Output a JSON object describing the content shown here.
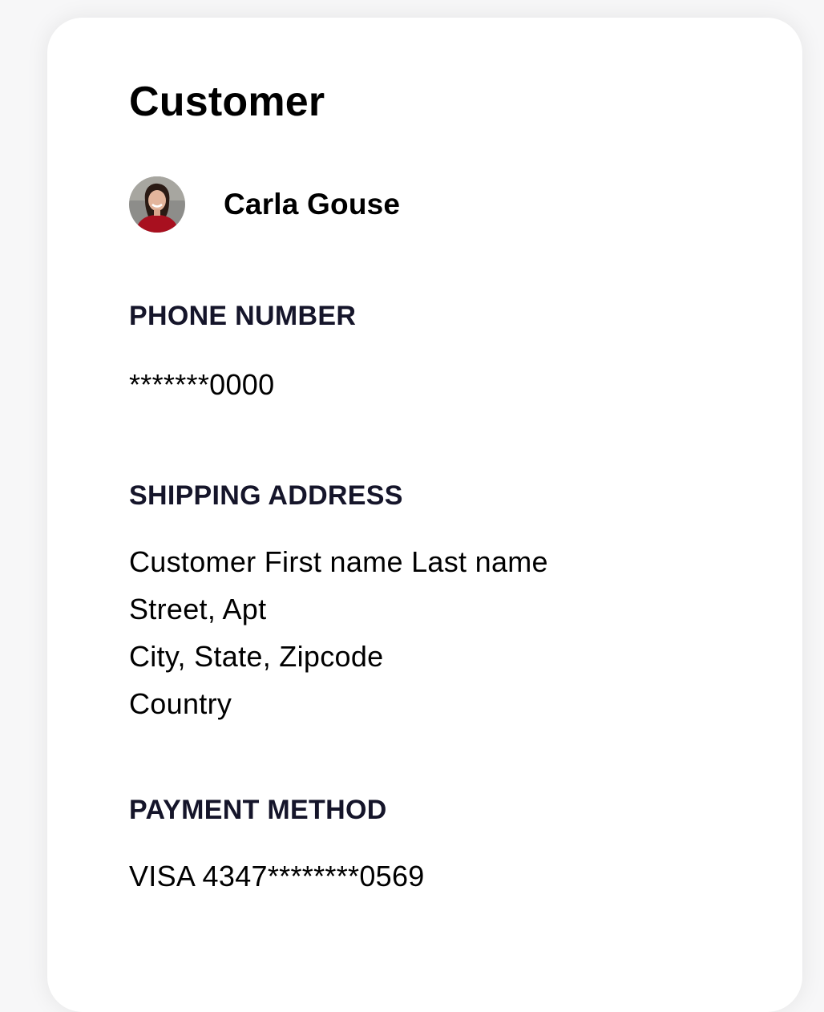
{
  "card": {
    "title": "Customer"
  },
  "customer": {
    "name": "Carla Gouse",
    "avatar_icon": "profile-photo"
  },
  "phone": {
    "label": "PHONE NUMBER",
    "value": "*******0000"
  },
  "shipping": {
    "label": "SHIPPING ADDRESS",
    "lines": [
      "Customer First name Last name",
      "Street, Apt",
      "City, State, Zipcode",
      "Country"
    ]
  },
  "payment": {
    "label": "PAYMENT METHOD",
    "value": "VISA 4347********0569"
  }
}
